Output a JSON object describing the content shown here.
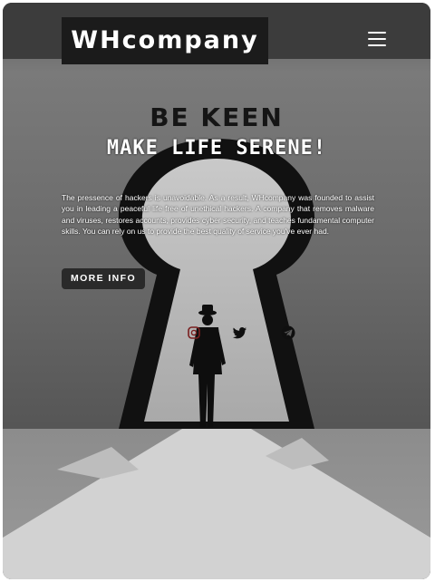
{
  "brand": {
    "name": "WHcompany"
  },
  "nav": {
    "menu_icon": "hamburger-menu-icon"
  },
  "hero": {
    "headline": "BE KEEN",
    "subheadline": "MAKE LIFE SERENE!",
    "description": "The pressence of hackers is unavoidable. As a result, WHcompany was founded to assist you in leading a peaceful life free of unethical hackers. A company that removes malware and viruses, restores accounts, provides cyber security, and teaches fundamental computer skills. You can rely on us to provide the best quality of service you've ever had.",
    "cta_label": "MORE INFO"
  },
  "social": [
    {
      "icon": "instagram-icon"
    },
    {
      "icon": "twitter-icon"
    },
    {
      "icon": "telegram-icon"
    }
  ],
  "colors": {
    "logo_bg": "#1b1b1b",
    "button_bg": "#2a2a2a",
    "text_light": "#ffffff",
    "text_dark": "#151515"
  }
}
